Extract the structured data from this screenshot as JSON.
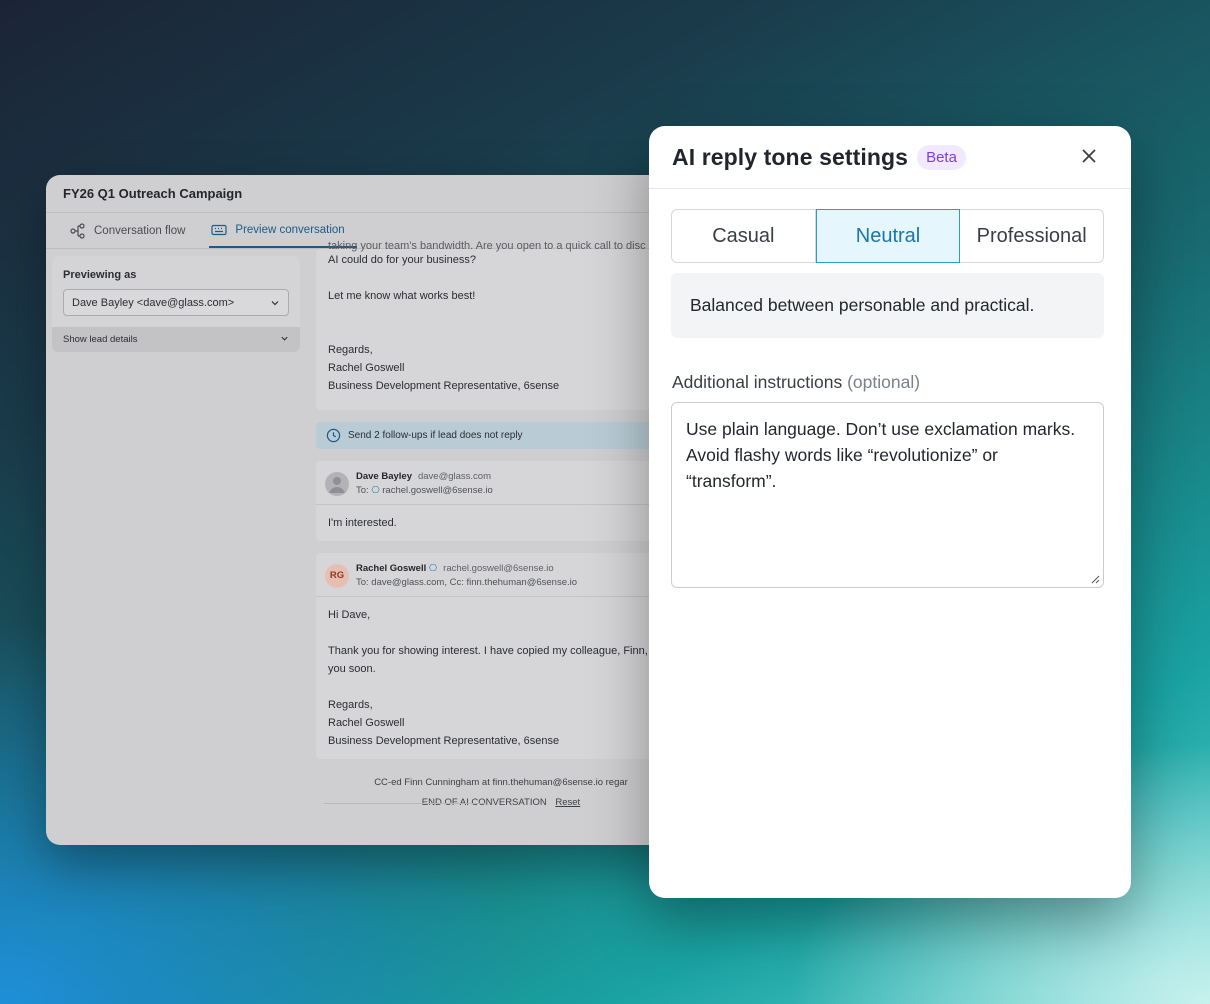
{
  "campaign": {
    "title": "FY26 Q1 Outreach Campaign",
    "tabs": [
      {
        "label": "Conversation flow",
        "icon": "flow-icon"
      },
      {
        "label": "Preview conversation",
        "icon": "keyboard-icon",
        "active": true
      }
    ],
    "previewing_label": "Previewing as",
    "previewing_value": "Dave Bayley <dave@glass.com>",
    "show_lead_details": "Show lead details",
    "email1": {
      "cut_text": "taking your team's bandwidth. Are you open to a quick call to disc",
      "lines": [
        "AI could do for your  business?",
        "",
        "Let me know what works best!",
        "",
        "",
        "Regards,",
        "Rachel Goswell",
        "Business Development Representative, 6sense"
      ]
    },
    "followup": "Send 2 follow-ups if lead does not reply",
    "reply": {
      "name": "Dave Bayley",
      "email": "dave@glass.com",
      "to": "To: ",
      "to_addr": "rachel.goswell@6sense.io",
      "body": "I'm interested."
    },
    "response": {
      "initials": "RG",
      "name": "Rachel Goswell",
      "email": "rachel.goswell@6sense.io",
      "to": "To: dave@glass.com, Cc: finn.thehuman@6sense.io",
      "lines": [
        "Hi Dave,",
        "",
        "Thank you for showing interest. I have copied my colleague, Finn,",
        "you soon.",
        "",
        "Regards,",
        "Rachel Goswell",
        "Business Development Representative, 6sense"
      ]
    },
    "cc_note": "CC-ed Finn Cunningham at finn.thehuman@6sense.io regar",
    "end_label": "END OF AI CONVERSATION",
    "reset_label": "Reset"
  },
  "modal": {
    "title": "AI reply tone settings",
    "badge": "Beta",
    "close_icon": "close-icon",
    "tones": [
      "Casual",
      "Neutral",
      "Professional"
    ],
    "selected_tone": "Neutral",
    "description": "Balanced between personable and practical.",
    "instructions_label": "Additional instructions",
    "instructions_optional": "(optional)",
    "instructions_value": "Use plain language. Don’t use exclamation marks. Avoid flashy words like “revolutionize” or “transform”."
  },
  "colors": {
    "accent": "#1b76a8",
    "badge": "#7e3fe0"
  }
}
